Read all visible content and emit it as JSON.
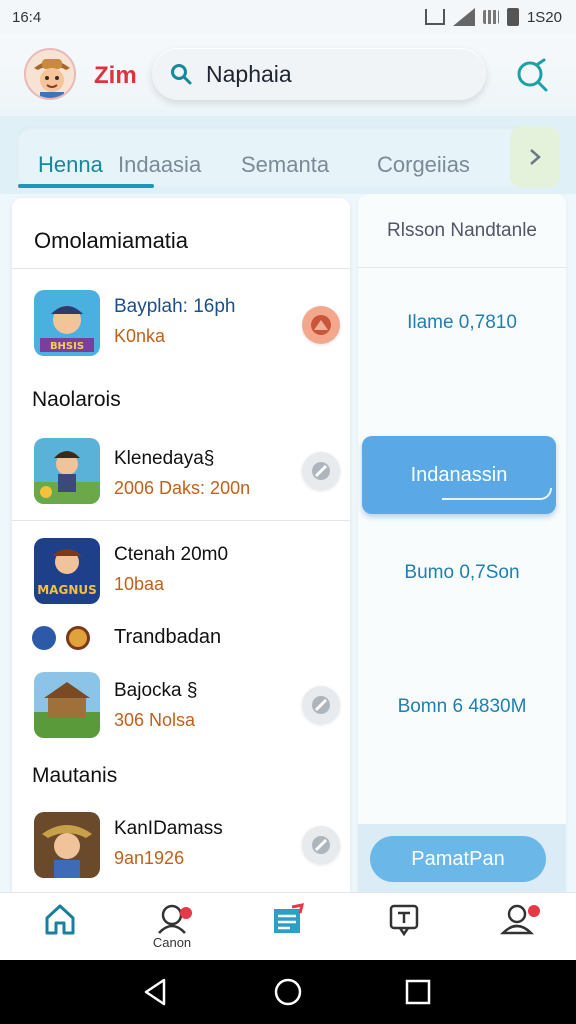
{
  "status_bar": {
    "time": "16:4",
    "battery_text": "1S20"
  },
  "header": {
    "user_name": "Zim",
    "search_value": "Naphaia"
  },
  "tabs": [
    {
      "label": "Henna",
      "active": true
    },
    {
      "label": "Indaasia",
      "active": false
    },
    {
      "label": "Semanta",
      "active": false
    },
    {
      "label": "Corgeiias",
      "active": false
    }
  ],
  "list": {
    "title": "Omolamiamatia",
    "sections": [
      "Naolarois",
      "Mautanis"
    ],
    "items": [
      {
        "title": "Bayplah: 16ph",
        "subtitle": "K0nka",
        "icon": "game-card-pirate"
      },
      {
        "title": "Klenedaya§",
        "subtitle": "2006 Daks: 200n",
        "icon": "game-card-adventurer"
      },
      {
        "title": "Ctenah 20m0",
        "subtitle": "10baa",
        "icon": "game-card-magnus"
      },
      {
        "title": "Bajocka §",
        "subtitle": "306 Nolsa",
        "icon": "game-card-temple"
      },
      {
        "title": "KanIDamass",
        "subtitle": "9an1926",
        "icon": "game-card-cowboy"
      }
    ],
    "inline_row": {
      "label": "Trandbadan"
    }
  },
  "right_panel": {
    "header": "Rlsson Nandtanle",
    "stats": [
      "Ilame 0,7810",
      "Bumo 0,7Son",
      "Bomn 6 4830M"
    ],
    "button": "Indanassin",
    "cta": "PamatPan"
  },
  "bottom_nav": [
    {
      "icon": "home-icon",
      "label": ""
    },
    {
      "icon": "messages-icon",
      "label": "Canon"
    },
    {
      "icon": "notes-icon",
      "label": ""
    },
    {
      "icon": "chat-icon",
      "label": ""
    },
    {
      "icon": "profile-icon",
      "label": ""
    }
  ],
  "colors": {
    "accent": "#17889a",
    "brand_red": "#e0313c",
    "link_blue": "#1f7fb2",
    "subtitle_orange": "#c0601a",
    "button_blue": "#5aa9e6"
  }
}
